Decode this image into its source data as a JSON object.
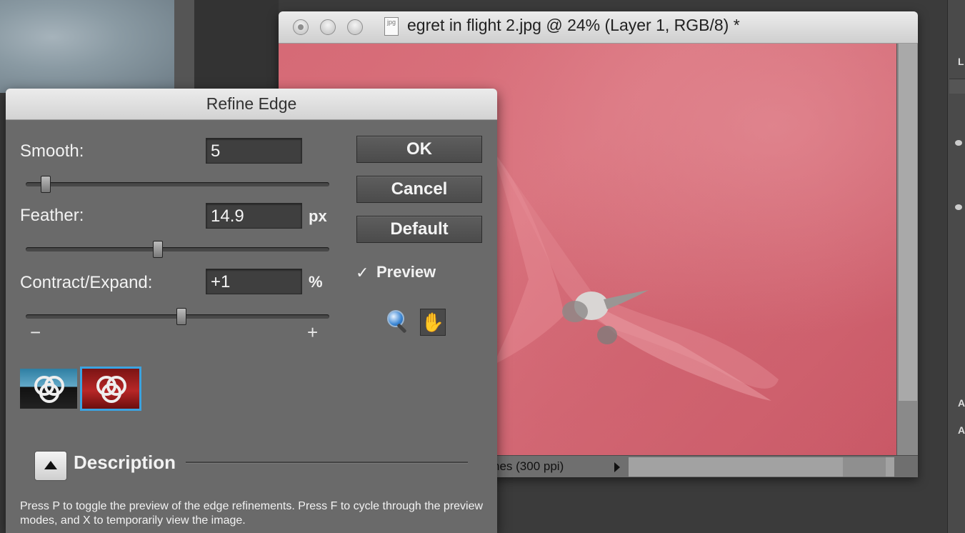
{
  "document": {
    "title": "egret in flight 2.jpg @ 24% (Layer 1, RGB/8) *",
    "status_text": "nes (300 ppi)",
    "file_icon": "document-icon"
  },
  "right_panel": {
    "labels": [
      "L",
      "A",
      "A"
    ]
  },
  "dialog": {
    "title": "Refine Edge",
    "smooth": {
      "label": "Smooth:",
      "value": "5",
      "slider_fraction": 0.05
    },
    "feather": {
      "label": "Feather:",
      "value": "14.9",
      "unit": "px",
      "slider_fraction": 0.43
    },
    "contract_expand": {
      "label": "Contract/Expand:",
      "value": "+1",
      "unit": "%",
      "slider_fraction": 0.51,
      "minus": "−",
      "plus": "+"
    },
    "buttons": {
      "ok": "OK",
      "cancel": "Cancel",
      "default": "Default"
    },
    "preview": {
      "label": "Preview",
      "checked": true,
      "check_glyph": "✓"
    },
    "tools": {
      "zoom": "zoom-icon",
      "hand": "hand-icon",
      "hand_glyph": "✋"
    },
    "preview_modes": [
      "standard-mode-icon",
      "quick-mask-mode-icon"
    ],
    "description": {
      "title": "Description",
      "text": "Press P to toggle the preview of the edge refinements. Press F to cycle through the preview modes, and X to temporarily view the image."
    }
  },
  "colors": {
    "canvas_red": "#d66a76",
    "selection_outline": "#3ba3e0"
  }
}
